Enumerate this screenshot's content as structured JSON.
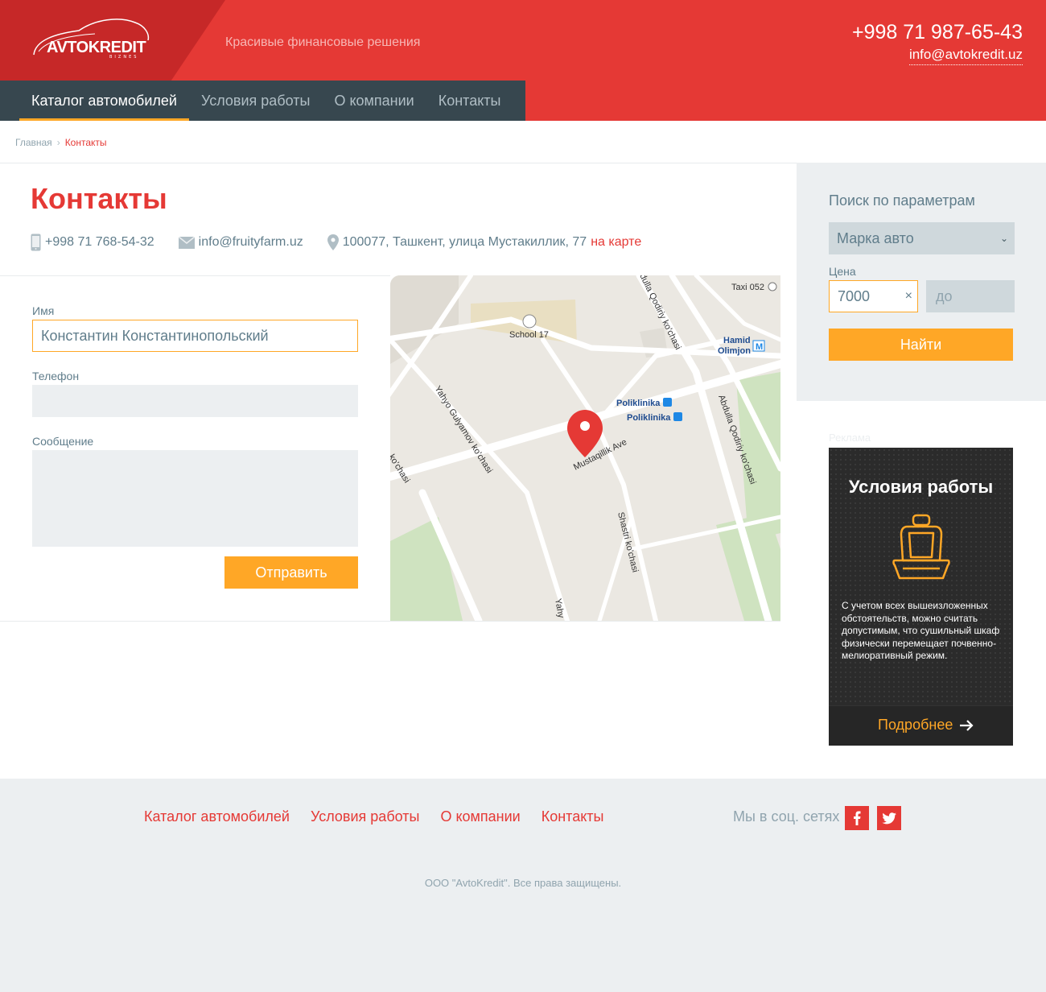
{
  "header": {
    "logo_text": "AVTOKREDIT",
    "logo_sub": "BIZNES",
    "tagline": "Красивые финансовые решения",
    "phone": "+998 71 987-65-43",
    "email": "info@avtokredit.uz"
  },
  "nav": {
    "items": [
      {
        "label": "Каталог автомобилей"
      },
      {
        "label": "Условия работы"
      },
      {
        "label": "О компании"
      },
      {
        "label": "Контакты"
      }
    ]
  },
  "breadcrumb": {
    "home": "Главная",
    "current": "Контакты"
  },
  "page": {
    "title": "Контакты",
    "phone": "+998 71 768-54-32",
    "email": "info@fruityfarm.uz",
    "address": "100077, Ташкент, улица Мустакиллик, 77",
    "map_link": "на карте"
  },
  "form": {
    "name_label": "Имя",
    "name_value": "Константин Константинопольский",
    "phone_label": "Телефон",
    "message_label": "Сообщение",
    "submit": "Отправить"
  },
  "map": {
    "labels": {
      "taxi": "Taxi 052",
      "school": "School 17",
      "hamid": "Hamid",
      "olimjon": "Olimjon",
      "poliklinika1": "Poliklinika",
      "poliklinika2": "Poliklinika",
      "mustaqillik": "Mustaqillik Ave",
      "yahyo": "Yahyo Gulyamov ko'chasi",
      "abdulla1": "Abdulla Qodiriy ko'chasi",
      "abdulla2": "dulla Qodiriy ko'chasi",
      "shastri": "Shastri ko'chasi",
      "kochasi": "ko'chasi",
      "yahy": "Yahy",
      "metro": "M"
    }
  },
  "sidebar": {
    "title": "Поиск по параметрам",
    "brand_select": "Марка авто",
    "price_label": "Цена",
    "price_from": "7000",
    "price_to_placeholder": "до",
    "search_button": "Найти"
  },
  "ad": {
    "label": "Реклама",
    "title": "Условия работы",
    "text": "С учетом всех вышеизложенных обстоятельств, можно считать допустимым, что сушильный шкаф физически перемещает почвенно-мелиоративный режим.",
    "more": "Подробнее"
  },
  "footer": {
    "nav": [
      {
        "label": "Каталог автомобилей"
      },
      {
        "label": "Условия работы"
      },
      {
        "label": "О компании"
      },
      {
        "label": "Контакты"
      }
    ],
    "social_label": "Мы в соц. сетях",
    "copyright": "ООО \"AvtoKredit\". Все права защищены."
  },
  "colors": {
    "brand_red": "#e53935",
    "dark_red": "#c62828",
    "nav_bg": "#37474f",
    "accent_orange": "#ffa726",
    "light_gray": "#eceff1"
  }
}
